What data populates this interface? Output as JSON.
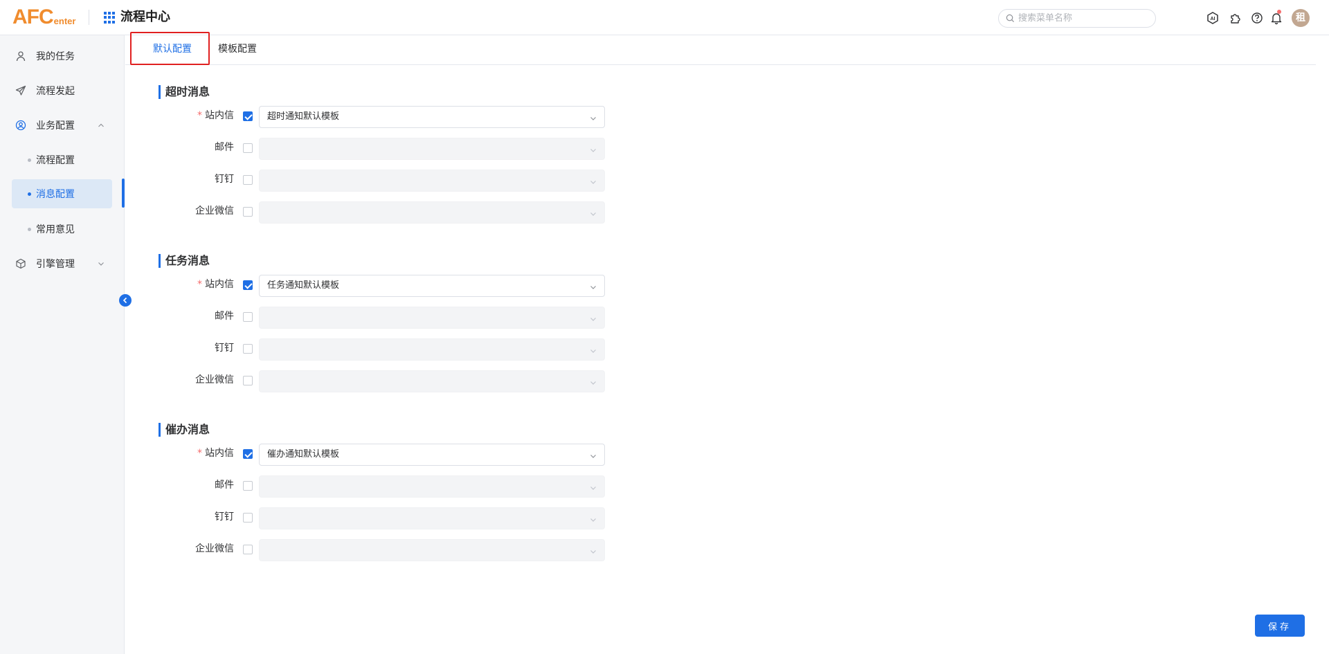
{
  "header": {
    "logo_big": "AFC",
    "logo_small": "enter",
    "title": "流程中心",
    "search_placeholder": "搜索菜单名称",
    "avatar_text": "租",
    "icons": [
      "ai-icon",
      "plugin-icon",
      "help-icon",
      "bell-icon"
    ]
  },
  "sidebar": {
    "items": [
      {
        "label": "我的任务",
        "icon": "user-icon"
      },
      {
        "label": "流程发起",
        "icon": "send-icon"
      },
      {
        "label": "业务配置",
        "icon": "user-circle-icon",
        "expanded": true
      },
      {
        "label": "引擎管理",
        "icon": "box-icon",
        "expanded": false
      }
    ],
    "sub_items": [
      {
        "label": "流程配置"
      },
      {
        "label": "消息配置",
        "active": true
      },
      {
        "label": "常用意见"
      }
    ]
  },
  "tabs": [
    {
      "label": "默认配置",
      "active": true
    },
    {
      "label": "模板配置",
      "active": false
    }
  ],
  "sections": [
    {
      "title": "超时消息",
      "rows": [
        {
          "label": "站内信",
          "required": true,
          "checked": true,
          "value": "超时通知默认模板"
        },
        {
          "label": "邮件",
          "required": false,
          "checked": false,
          "value": ""
        },
        {
          "label": "钉钉",
          "required": false,
          "checked": false,
          "value": ""
        },
        {
          "label": "企业微信",
          "required": false,
          "checked": false,
          "value": ""
        }
      ]
    },
    {
      "title": "任务消息",
      "rows": [
        {
          "label": "站内信",
          "required": true,
          "checked": true,
          "value": "任务通知默认模板"
        },
        {
          "label": "邮件",
          "required": false,
          "checked": false,
          "value": ""
        },
        {
          "label": "钉钉",
          "required": false,
          "checked": false,
          "value": ""
        },
        {
          "label": "企业微信",
          "required": false,
          "checked": false,
          "value": ""
        }
      ]
    },
    {
      "title": "催办消息",
      "rows": [
        {
          "label": "站内信",
          "required": true,
          "checked": true,
          "value": "催办通知默认模板"
        },
        {
          "label": "邮件",
          "required": false,
          "checked": false,
          "value": ""
        },
        {
          "label": "钉钉",
          "required": false,
          "checked": false,
          "value": ""
        },
        {
          "label": "企业微信",
          "required": false,
          "checked": false,
          "value": ""
        }
      ]
    }
  ],
  "save_label": "保存",
  "colors": {
    "accent": "#1f6fe5",
    "logo": "#f08c2e",
    "required": "#f56c6c",
    "highlight": "#e02020"
  }
}
